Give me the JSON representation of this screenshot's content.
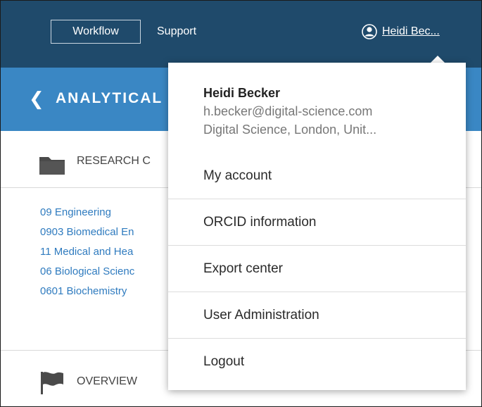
{
  "topbar": {
    "workflow_label": "Workflow",
    "support_label": "Support",
    "user_label": "Heidi Bec..."
  },
  "section": {
    "title": "ANALYTICAL",
    "back_icon": "chevron-left-icon"
  },
  "research_categories": {
    "label": "RESEARCH C",
    "icon": "folder-icon"
  },
  "categories": [
    "09 Engineering",
    "0903 Biomedical En",
    "11 Medical and Hea",
    "06 Biological Scienc",
    "0601 Biochemistry"
  ],
  "overview": {
    "label": "OVERVIEW",
    "icon": "flag-icon"
  },
  "dropdown": {
    "name": "Heidi Becker",
    "email": "h.becker@digital-science.com",
    "org": "Digital Science, London, Unit...",
    "items": [
      "My account",
      "ORCID information",
      "Export center",
      "User Administration",
      "Logout"
    ]
  },
  "colors": {
    "topbar": "#1f4a6b",
    "section_bar": "#3a87c4",
    "link": "#2f7bbf"
  }
}
